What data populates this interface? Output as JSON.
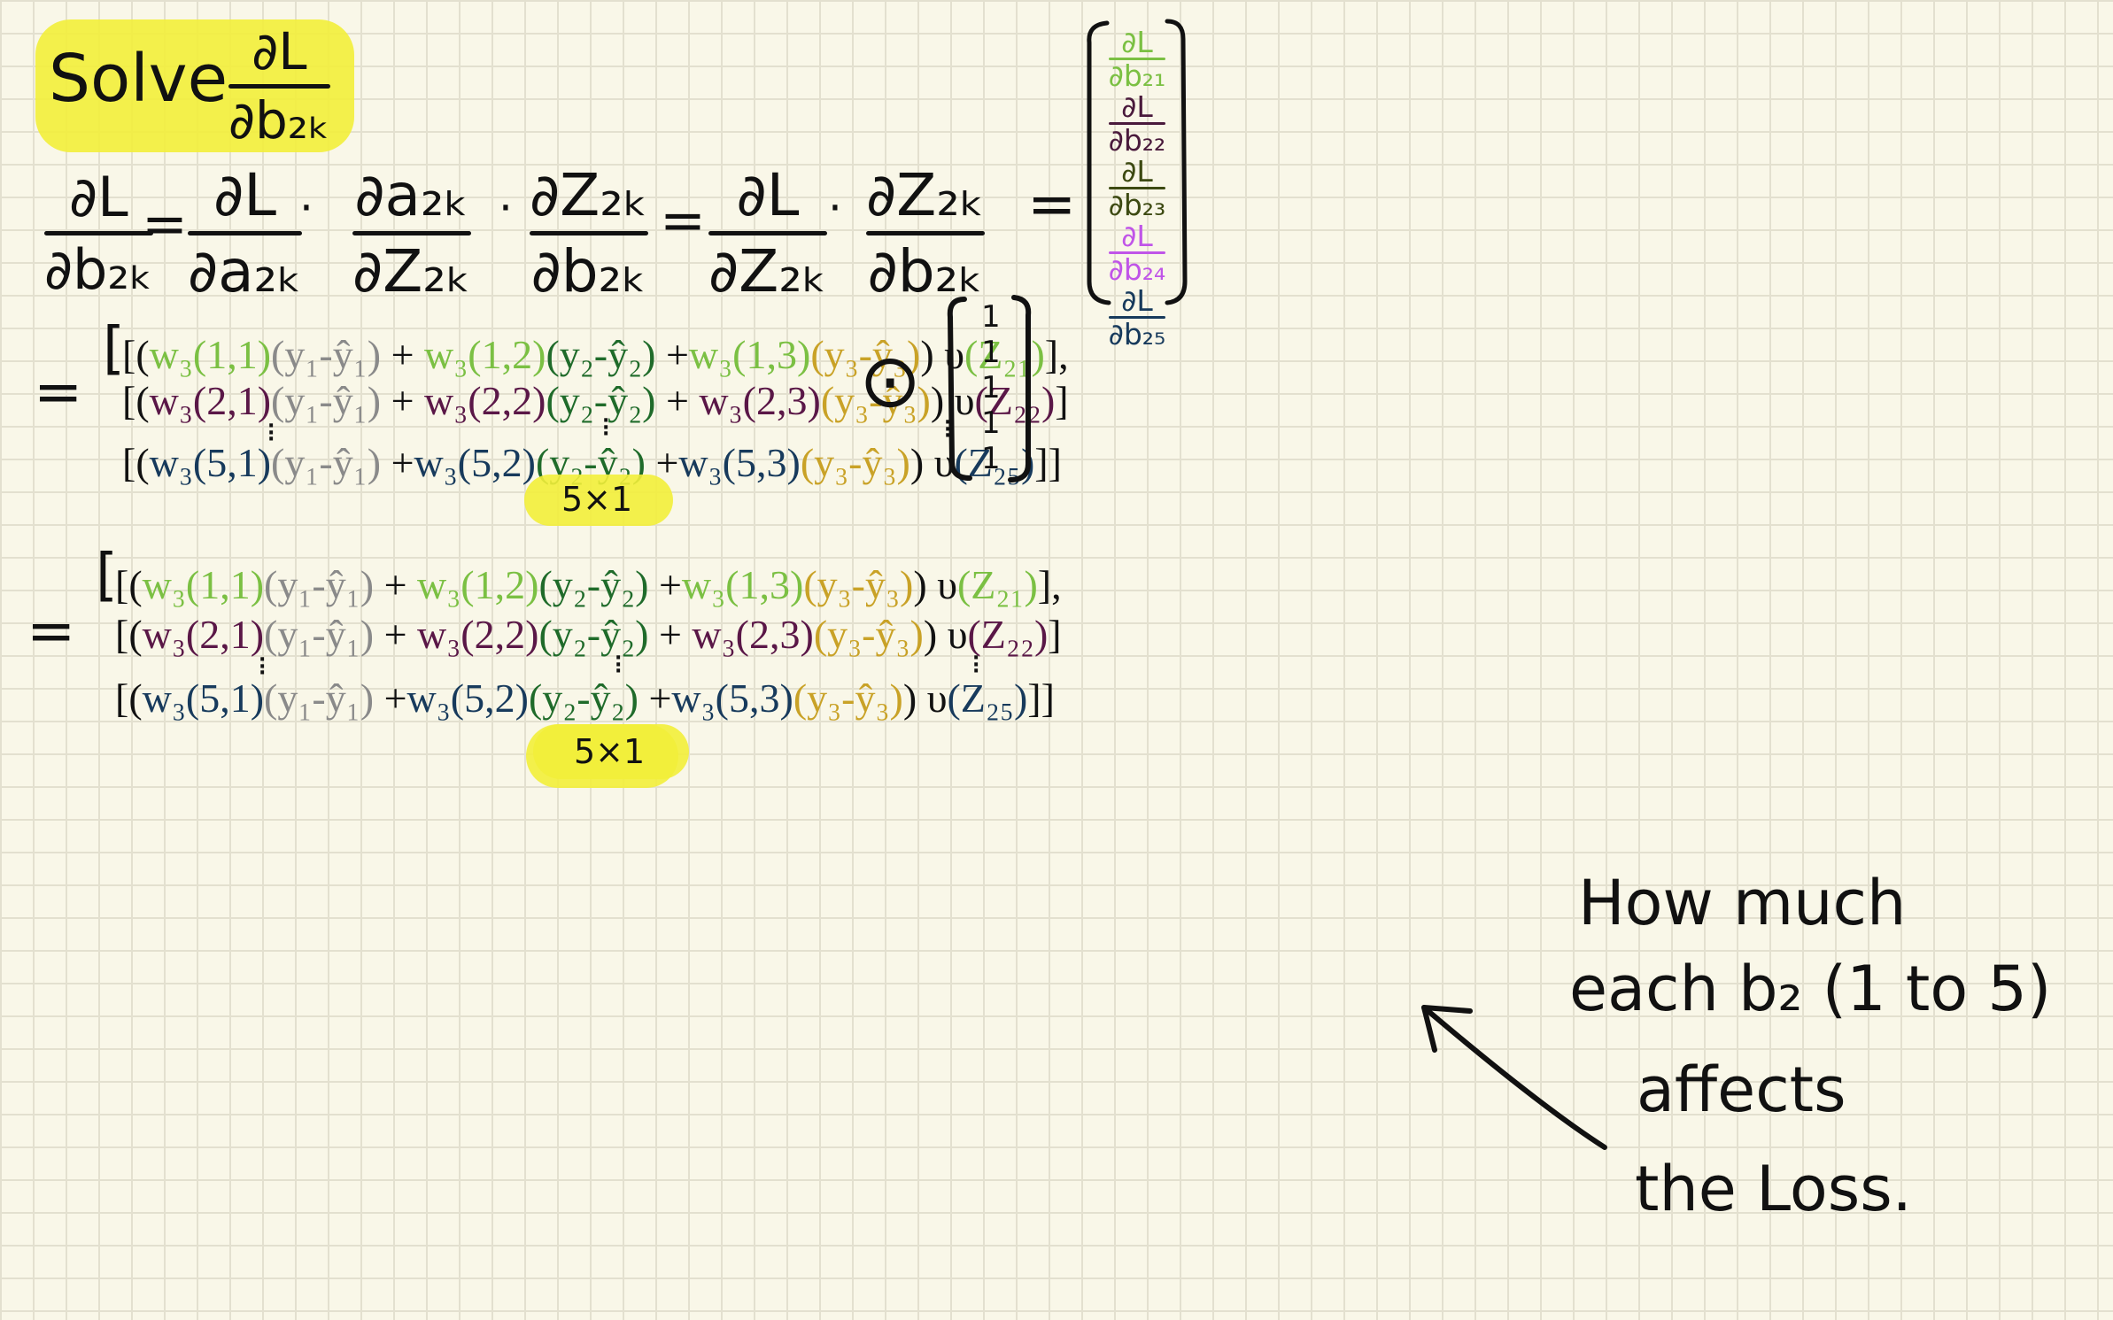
{
  "title": {
    "word": "Solve",
    "num": "∂L",
    "den": "∂b₂ₖ"
  },
  "chain": {
    "lhs": {
      "num": "∂L",
      "den": "∂b₂ₖ"
    },
    "f1": {
      "num": "∂L",
      "den": "∂a₂ₖ"
    },
    "f2": {
      "num": "∂a₂ₖ",
      "den": "∂Z₂ₖ"
    },
    "f3": {
      "num": "∂Z₂ₖ",
      "den": "∂b₂ₖ"
    },
    "f4": {
      "num": "∂L",
      "den": "∂Z₂ₖ"
    },
    "f5": {
      "num": "∂Z₂ₖ",
      "den": "∂b₂ₖ"
    },
    "dot": "·",
    "eq": "="
  },
  "gradient_vector": [
    {
      "num": "∂L",
      "den": "∂b₂₁",
      "color": "#7bc043"
    },
    {
      "num": "∂L",
      "den": "∂b₂₂",
      "color": "#4a1a3c"
    },
    {
      "num": "∂L",
      "den": "∂b₂₃",
      "color": "#3d4a12"
    },
    {
      "num": "∂L",
      "den": "∂b₂₄",
      "color": "#c055e8"
    },
    {
      "num": "∂L",
      "den": "∂b₂₅",
      "color": "#173a5c"
    }
  ],
  "block1": {
    "eq": "=",
    "open": "[",
    "row1": {
      "lb": "[(",
      "w11": "w₃(1,1)",
      "e1": "(y₁-ŷ₁)",
      "p1": "+",
      "w12": "w₃(1,2)",
      "e2": "(y₂-ŷ₂)",
      "p2": "+",
      "w13": "w₃(1,3)",
      "e3": "(y₃-ŷ₃)",
      "rp": ")",
      "u": "υ",
      "z": "(Z₂₁)",
      "end": "],"
    },
    "row2": {
      "lb": "[(",
      "w11": "w₃(2,1)",
      "e1": "(y₁-ŷ₁)",
      "p1": "+",
      "w12": "w₃(2,2)",
      "e2": "(y₂-ŷ₂)",
      "p2": "+",
      "w13": "w₃(2,3)",
      "e3": "(y₃-ŷ₃)",
      "rp": ")",
      "u": "υ",
      "z": "(Z₂₂)",
      "end": "]"
    },
    "row3": {
      "lb": "[(",
      "w11": "w₃(5,1)",
      "e1": "(y₁-ŷ₁)",
      "p1": "+",
      "w12": "w₃(5,2)",
      "e2": "(y₂-ŷ₂)",
      "p2": "+",
      "w13": "w₃(5,3)",
      "e3": "(y₃-ŷ₃)",
      "rp": ")",
      "u": "υ",
      "z": "(Z₂₅)",
      "end": "]]"
    },
    "dims": "5×1",
    "hadamard": "⊙",
    "ones": [
      "1",
      "1",
      "1",
      "1",
      "1"
    ]
  },
  "block2": {
    "eq": "=",
    "open": "[",
    "row1": {
      "lb": "[(",
      "w11": "w₃(1,1)",
      "e1": "(y₁-ŷ₁)",
      "p1": "+",
      "w12": "w₃(1,2)",
      "e2": "(y₂-ŷ₂)",
      "p2": "+",
      "w13": "w₃(1,3)",
      "e3": "(y₃-ŷ₃)",
      "rp": ")",
      "u": "υ",
      "z": "(Z₂₁)",
      "end": "],"
    },
    "row2": {
      "lb": "[(",
      "w11": "w₃(2,1)",
      "e1": "(y₁-ŷ₁)",
      "p1": "+",
      "w12": "w₃(2,2)",
      "e2": "(y₂-ŷ₂)",
      "p2": "+",
      "w13": "w₃(2,3)",
      "e3": "(y₃-ŷ₃)",
      "rp": ")",
      "u": "υ",
      "z": "(Z₂₂)",
      "end": "]"
    },
    "row3": {
      "lb": "[(",
      "w11": "w₃(5,1)",
      "e1": "(y₁-ŷ₁)",
      "p1": "+",
      "w12": "w₃(5,2)",
      "e2": "(y₂-ŷ₂)",
      "p2": "+",
      "w13": "w₃(5,3)",
      "e3": "(y₃-ŷ₃)",
      "rp": ")",
      "u": "υ",
      "z": "(Z₂₅)",
      "end": "]]"
    },
    "dims": "5×1"
  },
  "note": {
    "line1": "How much",
    "line2": "each b₂ (1 to 5)",
    "line3": "affects",
    "line4": "the Loss."
  },
  "colors": {
    "green": "#7bc043",
    "gray": "#8a8a8a",
    "gold": "#c9a227",
    "darkgreen": "#1f6b2a",
    "purple": "#5a1747",
    "navy": "#173a5c",
    "highlight": "#f2ee3a"
  }
}
